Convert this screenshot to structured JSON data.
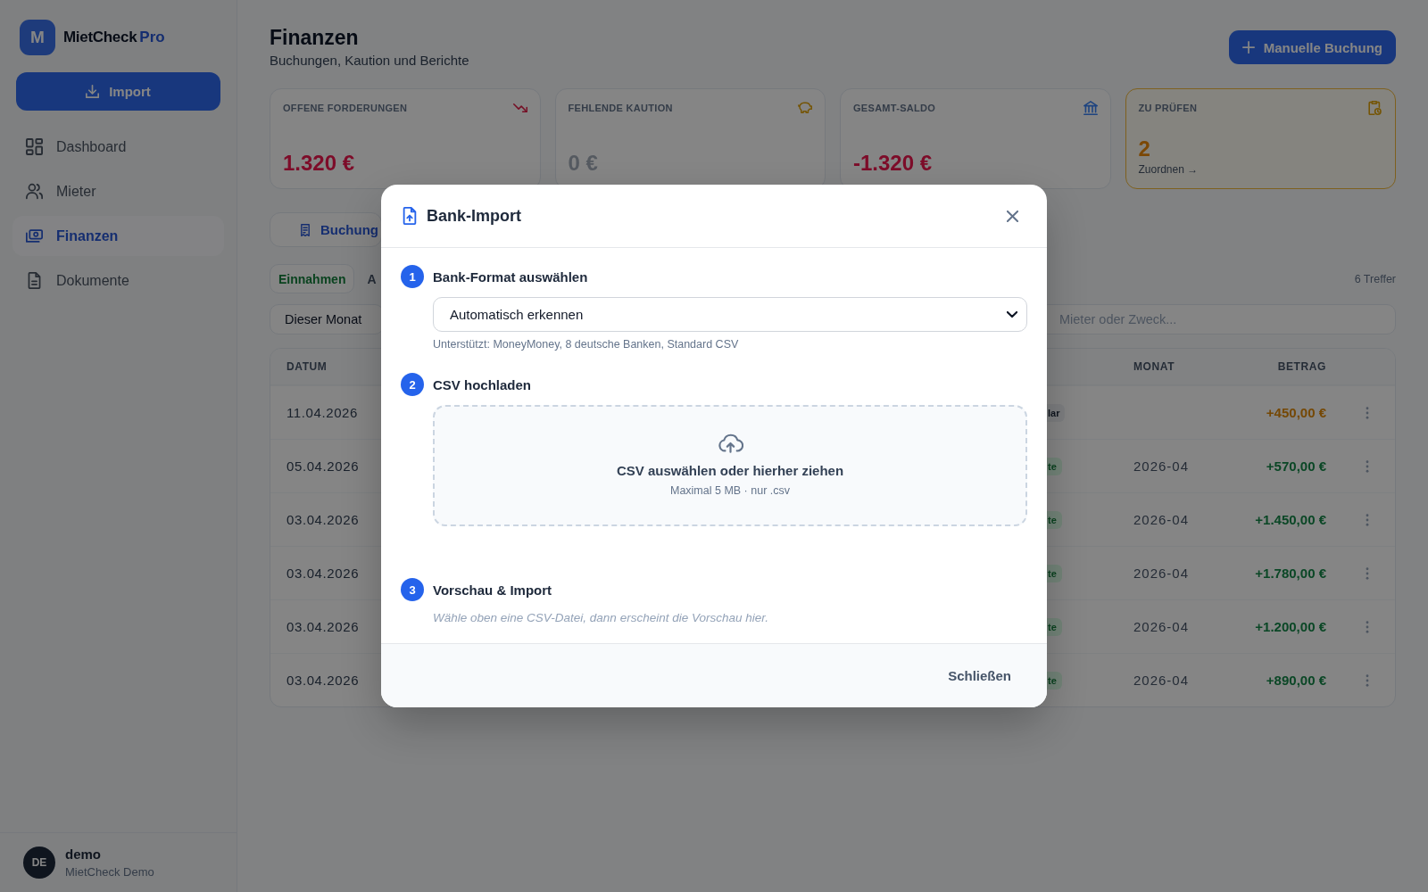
{
  "sidebar": {
    "logo": {
      "letter": "M",
      "name": "MietCheck",
      "edition": "Pro"
    },
    "import_button": {
      "label": "Import"
    },
    "nav_items": [
      {
        "label": "Dashboard",
        "selected": false
      },
      {
        "label": "Mieter",
        "selected": false
      },
      {
        "label": "Finanzen",
        "selected": true
      },
      {
        "label": "Dokumente",
        "selected": false
      }
    ],
    "user": {
      "initials": "DE",
      "name": "demo",
      "subtitle": "MietCheck Demo"
    }
  },
  "header": {
    "title": "Finanzen",
    "subtitle": "Buchungen, Kaution und Berichte",
    "action_button": {
      "label": "Manuelle Buchung"
    }
  },
  "stat_cards": [
    {
      "label": "OFFENE FORDERUNGEN",
      "value": "1.320 €",
      "kind": "negative"
    },
    {
      "label": "FEHLENDE KAUTION",
      "value": "0 €",
      "kind": "neutral"
    },
    {
      "label": "GESAMT-SALDO",
      "value": "-1.320 €",
      "kind": "negative"
    },
    {
      "label": "ZU PRÜFEN",
      "value": "2",
      "kind": "attention",
      "link": "Zuordnen →"
    }
  ],
  "tabs": [
    {
      "label": "Buchung",
      "selected": true
    }
  ],
  "filters": {
    "types": [
      {
        "label": "Einnahmen",
        "selected": true
      },
      {
        "label": "A",
        "selected": false
      }
    ],
    "result_count": "6 Treffer",
    "period": {
      "value": "Dieser Monat"
    },
    "search": {
      "placeholder": "Mieter oder Zweck..."
    }
  },
  "table": {
    "columns": [
      "DATUM",
      "MONAT",
      "BETRAG"
    ],
    "rows": [
      {
        "date": "11.04.2026",
        "tag": "lar",
        "amount": "+450,00 €",
        "kind": "pending"
      },
      {
        "date": "05.04.2026",
        "tag": "te",
        "month": "2026-04",
        "amount": "+570,00 €",
        "kind": "booked"
      },
      {
        "date": "03.04.2026",
        "tag": "te",
        "month": "2026-04",
        "amount": "+1.450,00 €",
        "kind": "booked"
      },
      {
        "date": "03.04.2026",
        "tag": "te",
        "month": "2026-04",
        "amount": "+1.780,00 €",
        "kind": "booked"
      },
      {
        "date": "03.04.2026",
        "tag": "te",
        "month": "2026-04",
        "amount": "+1.200,00 €",
        "kind": "booked"
      },
      {
        "date": "03.04.2026",
        "tag": "te",
        "month": "2026-04",
        "amount": "+890,00 €",
        "kind": "booked"
      }
    ]
  },
  "modal": {
    "title": "Bank-Import",
    "steps": [
      {
        "number": "1",
        "title": "Bank-Format auswählen",
        "kind": "select",
        "value": "Automatisch erkennen",
        "hint": "Unterstützt: MoneyMoney, 8 deutsche Banken, Standard CSV"
      },
      {
        "number": "2",
        "title": "CSV hochladen",
        "kind": "upload",
        "prompt": "CSV auswählen oder hierher ziehen",
        "hint": "Maximal 5 MB · nur .csv"
      },
      {
        "number": "3",
        "title": "Vorschau & Import",
        "kind": "preview",
        "hint": "Wähle oben eine CSV-Datei, dann erscheint die Vorschau hier."
      }
    ],
    "close_button": "Schließen"
  }
}
